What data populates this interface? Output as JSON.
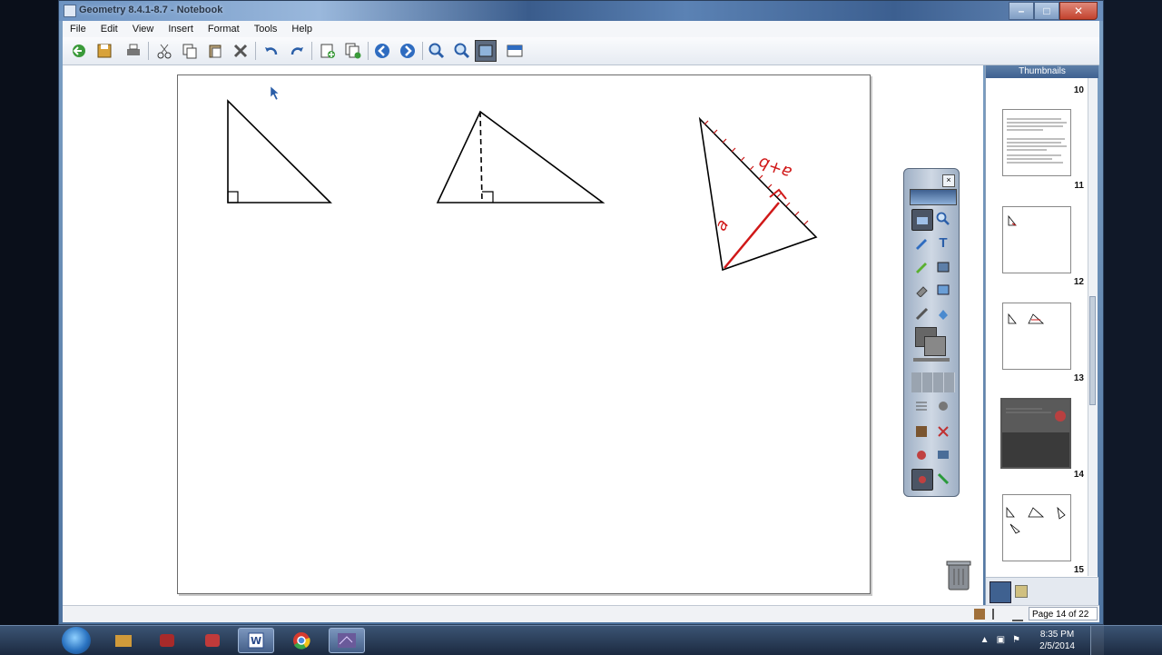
{
  "window": {
    "title": "Geometry 8.4.1-8.7 - Notebook",
    "controls": {
      "minimize": "–",
      "maximize": "□",
      "close": "✕"
    }
  },
  "menu": [
    "File",
    "Edit",
    "View",
    "Insert",
    "Format",
    "Tools",
    "Help"
  ],
  "toolbar": {
    "icons": [
      "back-icon",
      "save-icon",
      "print-icon",
      "cut-icon",
      "copy-icon",
      "paste-icon",
      "delete-icon",
      "undo-icon",
      "redo-icon",
      "insert-page-icon",
      "duplicate-page-icon",
      "previous-page-icon",
      "next-page-icon",
      "zoom-in-icon",
      "zoom-out-icon",
      "full-screen-icon",
      "screen-shade-icon"
    ]
  },
  "canvas": {
    "annotation_labels": [
      "a+b",
      "a"
    ],
    "annotation_color": "#d01818"
  },
  "toolbox": {
    "tools": [
      "camera",
      "zoom",
      "pen",
      "text",
      "highlighter",
      "fill",
      "eraser",
      "image",
      "line",
      "shape",
      "color",
      "line-width",
      "table",
      "misc",
      "delete",
      "settings"
    ]
  },
  "thumbnails": {
    "header": "Thumbnails",
    "pages": [
      {
        "number": "10"
      },
      {
        "number": "11"
      },
      {
        "number": "12"
      },
      {
        "number": "13"
      },
      {
        "number": "14",
        "selected": true
      },
      {
        "number": "15"
      }
    ]
  },
  "status": {
    "page_indicator": "Page 14 of 22"
  },
  "taskbar": {
    "time": "8:35 PM",
    "date": "2/5/2014",
    "apps": [
      "explorer",
      "media",
      "app-red",
      "word",
      "chrome",
      "notebook"
    ]
  },
  "colors": {
    "accent": "#3f6190",
    "ink": "#d01818"
  }
}
